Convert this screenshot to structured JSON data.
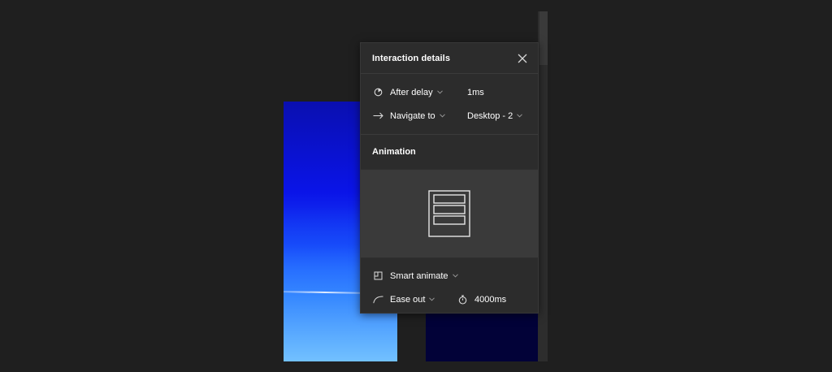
{
  "panel": {
    "title": "Interaction details",
    "trigger": {
      "label": "After delay",
      "value": "1ms"
    },
    "action": {
      "label": "Navigate to",
      "destination": "Desktop - 2"
    },
    "animation": {
      "title": "Animation",
      "type": "Smart animate",
      "easing": "Ease out",
      "duration": "4000ms"
    }
  },
  "colors": {
    "panel_bg": "#2c2c2c",
    "preview_bg": "#3a3a3a",
    "canvas_bg": "#1f1f1f",
    "frame_left_gradient": [
      "#0a0fb0",
      "#3a7dff"
    ],
    "frame_right": "#020238"
  },
  "icons": {
    "close": "close-icon",
    "trigger": "timer-icon",
    "action": "arrow-right-icon",
    "animation_type": "smart-animate-icon",
    "easing": "ease-curve-icon",
    "duration": "stopwatch-icon"
  }
}
